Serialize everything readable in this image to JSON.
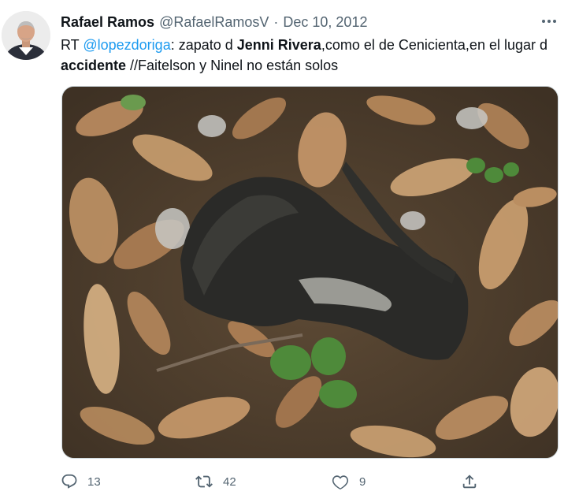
{
  "tweet": {
    "display_name": "Rafael Ramos",
    "handle": "@RafaelRamosV",
    "separator": "·",
    "date": "Dec 10, 2012",
    "text": {
      "rt": "RT ",
      "mention": "@lopezdoriga",
      "part1": ": zapato d ",
      "bold1": "Jenni Rivera",
      "part2": ",como el de Cenicienta,en el lugar d ",
      "bold2": "accidente",
      "part3": "  //Faitelson y Ninel no están solos"
    },
    "media": {
      "description_icon": "photo"
    },
    "actions": {
      "reply_count": "13",
      "retweet_count": "42",
      "like_count": "9"
    }
  },
  "icons": {
    "avatar": "profile-photo",
    "more": "more-dots-icon",
    "reply": "reply-icon",
    "retweet": "retweet-icon",
    "like": "heart-icon",
    "share": "share-icon"
  },
  "colors": {
    "link": "#1d9bf0",
    "secondary": "#536471",
    "text": "#0f1419"
  }
}
